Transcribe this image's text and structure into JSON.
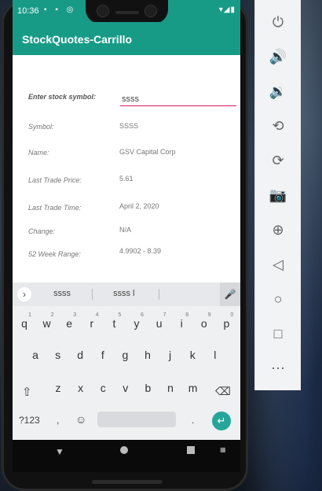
{
  "status": {
    "time": "10:36"
  },
  "app": {
    "title": "StockQuotes-Carrillo"
  },
  "form": {
    "symbol_prompt": "Enter stock symbol:",
    "symbol_input_value": "ssss",
    "fields": [
      {
        "label": "Symbol:",
        "value": "SSSS"
      },
      {
        "label": "Name:",
        "value": "GSV Capital Corp"
      },
      {
        "label": "Last Trade Price:",
        "value": "5.61"
      },
      {
        "label": "Last Trade Time:",
        "value": "April 2, 2020"
      },
      {
        "label": "Change:",
        "value": "N/A"
      },
      {
        "label": "52 Week Range:",
        "value": "4.9902 - 8.39"
      }
    ]
  },
  "keyboard": {
    "suggestions": [
      "ssss",
      "ssss l"
    ],
    "row1": [
      "q",
      "w",
      "e",
      "r",
      "t",
      "y",
      "u",
      "i",
      "o",
      "p"
    ],
    "row1_hints": [
      "1",
      "2",
      "3",
      "4",
      "5",
      "6",
      "7",
      "8",
      "9",
      "0"
    ],
    "row2": [
      "a",
      "s",
      "d",
      "f",
      "g",
      "h",
      "j",
      "k",
      "l"
    ],
    "row3": [
      "z",
      "x",
      "c",
      "v",
      "b",
      "n",
      "m"
    ],
    "symbols_key": "?123",
    "comma_key": ",",
    "period_key": "."
  },
  "colors": {
    "accent": "#189b86",
    "input_underline": "#d81b60",
    "enter": "#26a69a"
  },
  "side_panel_icons": [
    "power-icon",
    "volume-up-icon",
    "volume-down-icon",
    "rotate-left-icon",
    "rotate-right-icon",
    "camera-icon",
    "zoom-icon",
    "back-icon",
    "home-icon",
    "overview-icon",
    "more-icon"
  ]
}
